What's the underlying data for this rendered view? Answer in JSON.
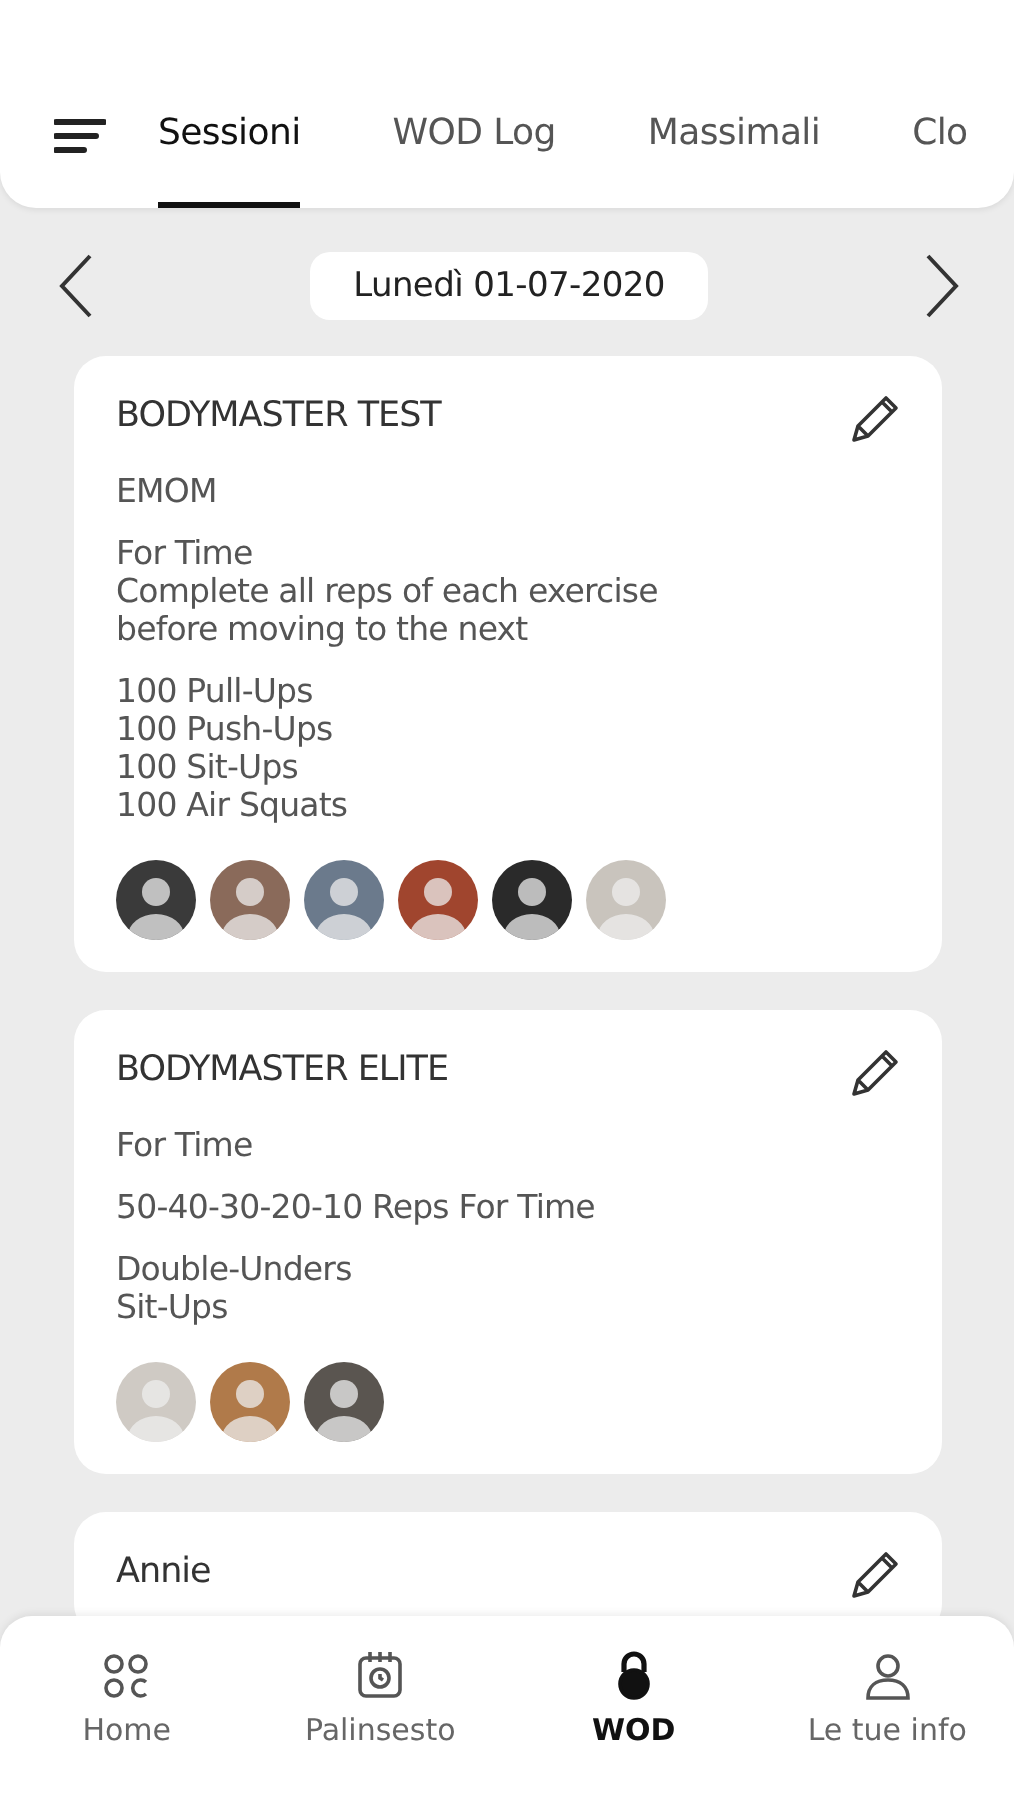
{
  "tabs": [
    {
      "label": "Sessioni",
      "selected": true
    },
    {
      "label": "WOD Log",
      "selected": false
    },
    {
      "label": "Massimali",
      "selected": false
    },
    {
      "label": "Clo",
      "selected": false
    }
  ],
  "date": {
    "label": "Lunedì 01-07-2020"
  },
  "sessions": [
    {
      "title": "BODYMASTER TEST",
      "blocks": [
        [
          "EMOM"
        ],
        [
          "For Time",
          "Complete all reps of each exercise",
          "before moving to the next"
        ],
        [
          "100 Pull-Ups",
          "100 Push-Ups",
          "100 Sit-Ups",
          "100 Air Squats"
        ]
      ],
      "avatars": [
        {
          "kind": "avatar",
          "color": "#3a3a3a"
        },
        {
          "kind": "avatar",
          "color": "#8a6a5a"
        },
        {
          "kind": "avatar",
          "color": "#6b7a8c"
        },
        {
          "kind": "avatar",
          "color": "#a0452e"
        },
        {
          "kind": "avatar",
          "color": "#2a2a2a"
        },
        {
          "kind": "avatar",
          "color": "#c9c4bd"
        }
      ]
    },
    {
      "title": "BODYMASTER ELITE",
      "blocks": [
        [
          "For Time"
        ],
        [
          "50-40-30-20-10 Reps For Time"
        ],
        [
          "Double-Unders",
          "Sit-Ups"
        ]
      ],
      "avatars": [
        {
          "kind": "avatar",
          "color": "#cfcac4"
        },
        {
          "kind": "avatar",
          "color": "#b07a4a"
        },
        {
          "kind": "avatar",
          "color": "#5a5550"
        }
      ]
    },
    {
      "title": "Annie"
    }
  ],
  "nav": [
    {
      "label": "Home",
      "selected": false
    },
    {
      "label": "Palinsesto",
      "selected": false
    },
    {
      "label": "WOD",
      "selected": true
    },
    {
      "label": "Le tue info",
      "selected": false
    }
  ]
}
